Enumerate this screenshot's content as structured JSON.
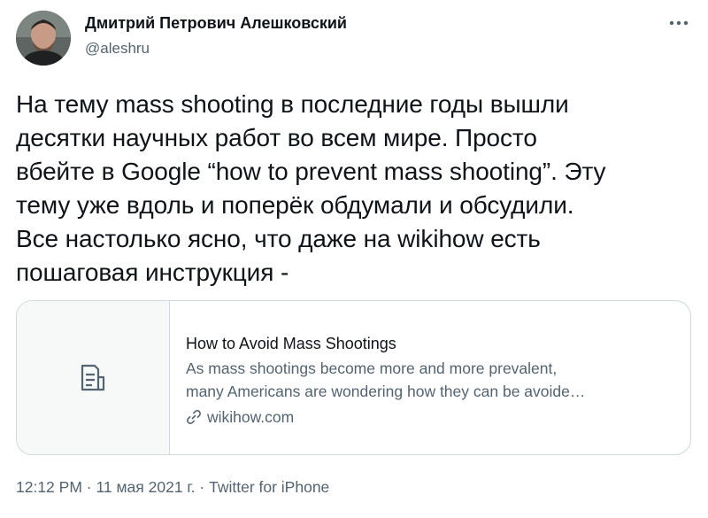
{
  "author": {
    "display_name": "Дмитрий Петрович Алешковский",
    "handle": "@aleshru",
    "avatar_icon": "user-avatar"
  },
  "header": {
    "more_icon": "more-horizontal-icon"
  },
  "tweet": {
    "text": "На тему mass shooting в последние годы вышли\nдесятки научных работ во всем мире. Просто\nвбейте в Google “how to prevent mass shooting”. Эту\nтему уже вдоль и поперёк обдумали и обсудили.\nВсе настолько ясно, что даже на wikihow есть\nпошаговая инструкция -"
  },
  "link_card": {
    "thumbnail_icon": "document-icon",
    "title": "How to Avoid Mass Shootings",
    "description": "As mass shootings become more and more prevalent,\nmany Americans are wondering how they can be avoide…",
    "domain_icon": "link-icon",
    "domain": "wikihow.com"
  },
  "meta": {
    "time": "12:12 PM",
    "separator": "·",
    "date": "11 мая 2021 г.",
    "source": "Twitter for iPhone"
  },
  "colors": {
    "primary_text": "#0f1419",
    "secondary_text": "#536471",
    "border": "#cfd9de",
    "card_thumb_bg": "#f7f9f9"
  }
}
